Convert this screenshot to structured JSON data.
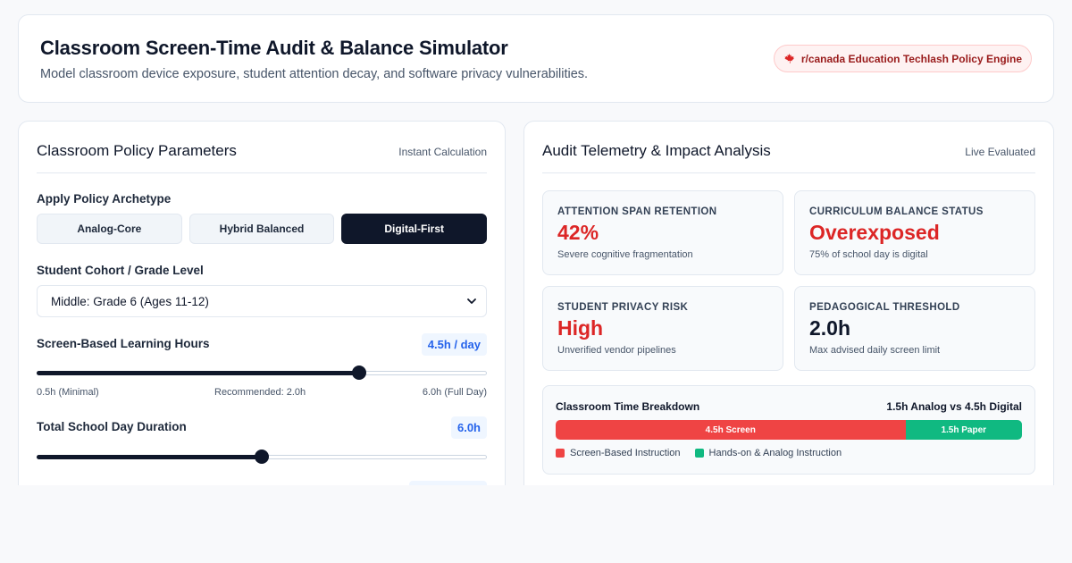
{
  "header": {
    "title": "Classroom Screen-Time Audit & Balance Simulator",
    "subtitle": "Model classroom device exposure, student attention decay, and software privacy vulnerabilities.",
    "badge": "r/canada Education Techlash Policy Engine",
    "badge_icon": "maple-leaf-icon"
  },
  "left_panel": {
    "title": "Classroom Policy Parameters",
    "meta": "Instant Calculation",
    "archetype": {
      "label": "Apply Policy Archetype",
      "options": [
        "Analog-Core",
        "Hybrid Balanced",
        "Digital-First"
      ],
      "selected": "Digital-First"
    },
    "cohort": {
      "label": "Student Cohort / Grade Level",
      "selected": "Middle: Grade 6 (Ages 11-12)"
    },
    "screen_hours": {
      "label": "Screen-Based Learning Hours",
      "value_text": "4.5h / day",
      "value": 4.5,
      "min": 0.5,
      "max": 6.0,
      "scale_min": "0.5h (Minimal)",
      "scale_mid": "Recommended: 2.0h",
      "scale_max": "6.0h (Full Day)"
    },
    "school_day": {
      "label": "Total School Day Duration",
      "value_text": "6.0h",
      "value": 6.0,
      "fraction": 0.5
    }
  },
  "right_panel": {
    "title": "Audit Telemetry & Impact Analysis",
    "meta": "Live Evaluated",
    "metrics": [
      {
        "label": "ATTENTION SPAN RETENTION",
        "value": "42%",
        "note": "Severe cognitive fragmentation",
        "color": "#dc2626"
      },
      {
        "label": "CURRICULUM BALANCE STATUS",
        "value": "Overexposed",
        "note": "75% of school day is digital",
        "color": "#dc2626"
      },
      {
        "label": "STUDENT PRIVACY RISK",
        "value": "High",
        "note": "Unverified vendor pipelines",
        "color": "#dc2626"
      },
      {
        "label": "PEDAGOGICAL THRESHOLD",
        "value": "2.0h",
        "note": "Max advised daily screen limit",
        "color": "#0f172a"
      }
    ],
    "breakdown": {
      "title": "Classroom Time Breakdown",
      "summary": "1.5h Analog vs 4.5h Digital",
      "screen_label": "4.5h Screen",
      "paper_label": "1.5h Paper",
      "screen_hours": 4.5,
      "paper_hours": 1.5,
      "screen_color": "#ef4444",
      "paper_color": "#10b981",
      "legend_screen": "Screen-Based Instruction",
      "legend_paper": "Hands-on & Analog Instruction"
    }
  }
}
